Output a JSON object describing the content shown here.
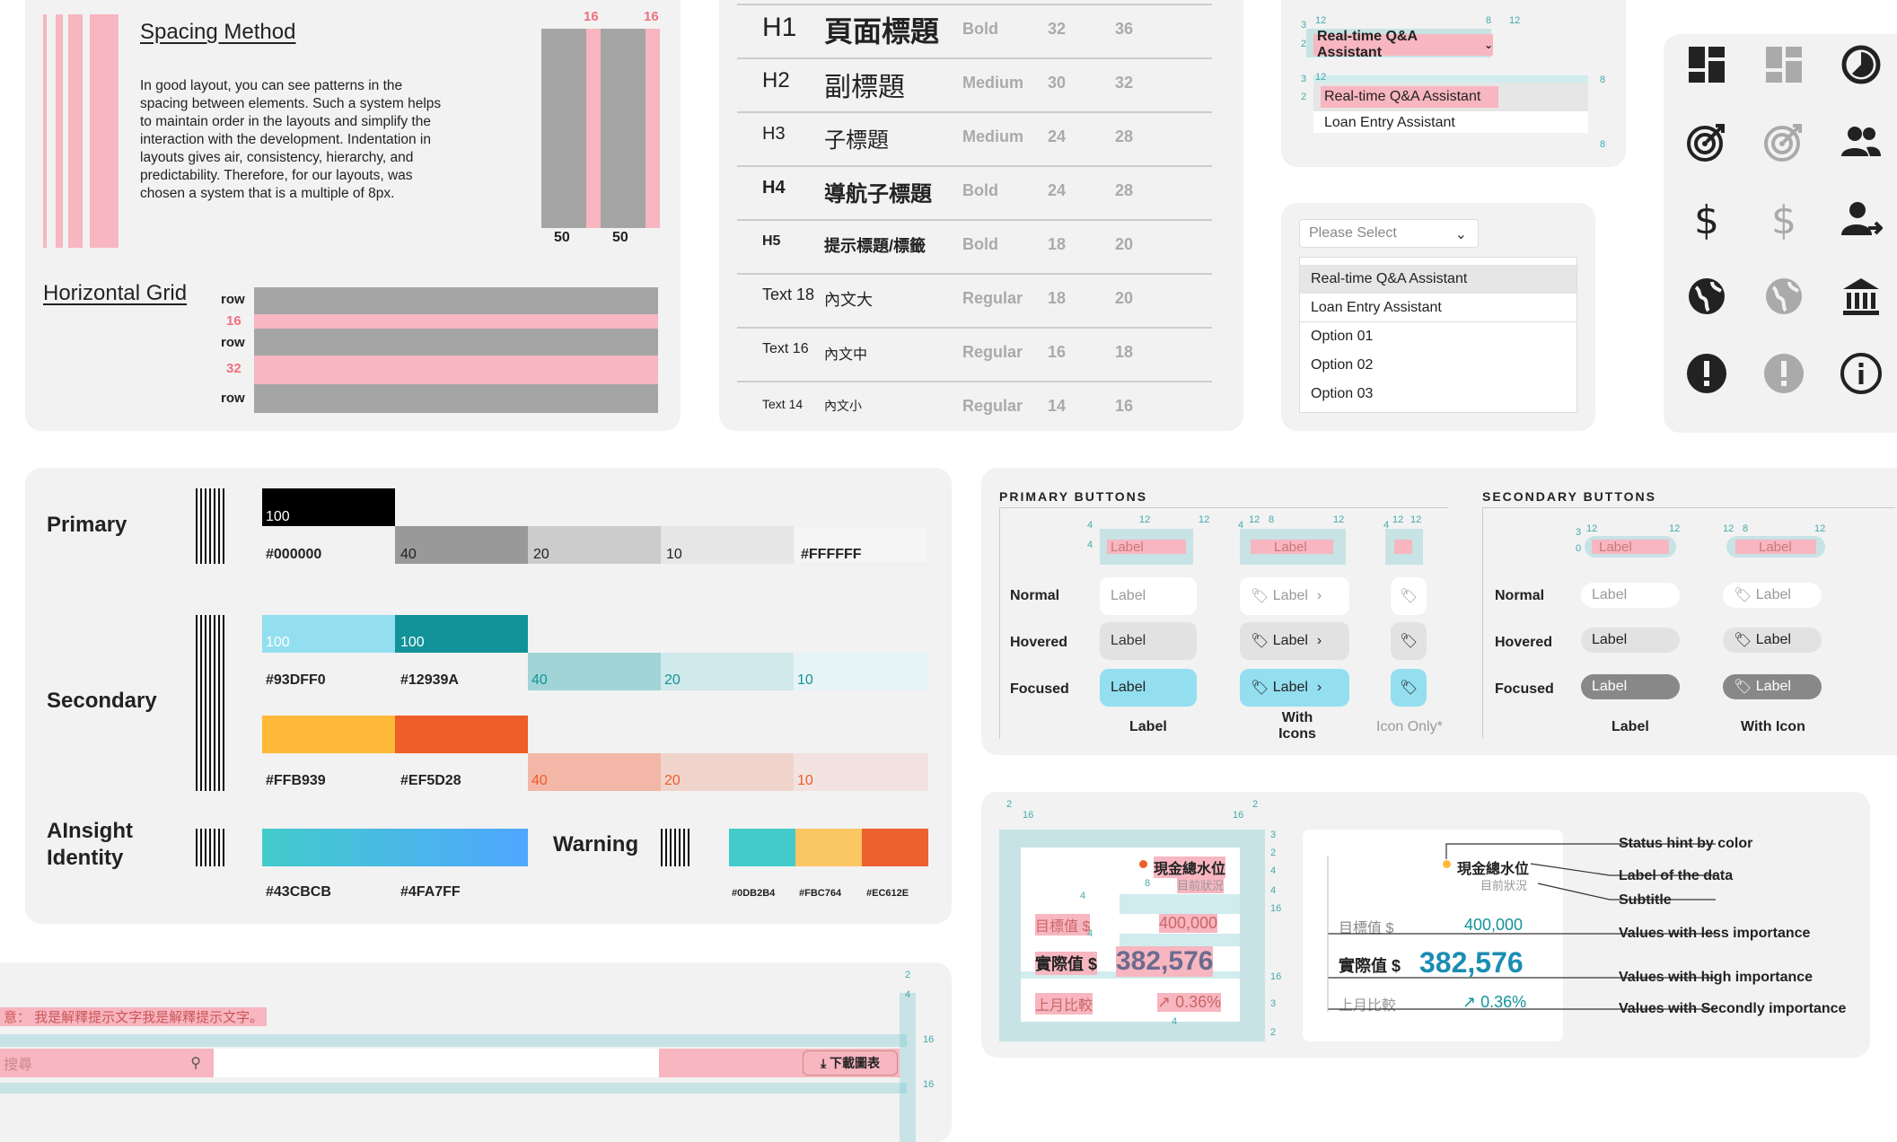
{
  "spacing": {
    "title": "Spacing Method",
    "body": "In good layout, you can see patterns in the spacing between elements. Such a system helps to maintain order in the layouts and simplify the interaction with the development. Indentation in layouts gives air, consistency, hierarchy, and predictability. Therefore, for our layouts, was chosen a system that is a multiple of 8px.",
    "gap1": "16",
    "gap2": "16",
    "col1": "50",
    "col2": "50"
  },
  "hgrid": {
    "title": "Horizontal Grid",
    "labels": [
      "row",
      "16",
      "row",
      "32",
      "row"
    ]
  },
  "typography": {
    "rows": [
      {
        "tag": "H1",
        "zh": "頁面標題",
        "weight": "Bold",
        "size": "32",
        "line": "36"
      },
      {
        "tag": "H2",
        "zh": "副標題",
        "weight": "Medium",
        "size": "30",
        "line": "32"
      },
      {
        "tag": "H3",
        "zh": "子標題",
        "weight": "Medium",
        "size": "24",
        "line": "28"
      },
      {
        "tag": "H4",
        "zh": "導航子標題",
        "weight": "Bold",
        "size": "24",
        "line": "28"
      },
      {
        "tag": "H5",
        "zh": "提示標題/標籤",
        "weight": "Bold",
        "size": "18",
        "line": "20"
      },
      {
        "tag": "Text 18",
        "zh": "內文大",
        "weight": "Regular",
        "size": "18",
        "line": "20"
      },
      {
        "tag": "Text 16",
        "zh": "內文中",
        "weight": "Regular",
        "size": "16",
        "line": "18"
      },
      {
        "tag": "Text 14",
        "zh": "內文小",
        "weight": "Regular",
        "size": "14",
        "line": "16"
      }
    ]
  },
  "dropdown1": {
    "selected": "Real-time Q&A Assistant",
    "options": [
      "Real-time Q&A Assistant",
      "Loan Entry Assistant"
    ],
    "dims": [
      "3",
      "12",
      "2",
      "8",
      "12",
      "3",
      "12",
      "2",
      "8",
      "8"
    ]
  },
  "dropdown2": {
    "placeholder": "Please Select",
    "options": [
      "Real-time Q&A Assistant",
      "Loan Entry Assistant",
      "Option 01",
      "Option 02",
      "Option 03"
    ]
  },
  "icons": [
    "dashboard-icon",
    "dashboard-outline-icon",
    "timer-icon",
    "target-icon",
    "target-outline-icon",
    "people-icon",
    "dollar-icon",
    "dollar-outline-icon",
    "person-arrow-icon",
    "globe-icon",
    "globe-outline-icon",
    "bank-icon",
    "alert-icon",
    "alert-outline-icon",
    "info-icon"
  ],
  "colors": {
    "primary_label": "Primary",
    "primary_steps": [
      "100",
      "40",
      "20",
      "10"
    ],
    "primary_hex": [
      "#000000",
      "#FFFFFF"
    ],
    "secondary_label": "Secondary",
    "sec_a_vals": [
      "100",
      "100",
      "40",
      "20",
      "10"
    ],
    "sec_a_hex": [
      "#93DFF0",
      "#12939A"
    ],
    "sec_b_vals": [
      "40",
      "20",
      "10"
    ],
    "sec_b_hex": [
      "#FFB939",
      "#EF5D28"
    ],
    "identity_label": "AInsight Identity",
    "identity_hex": [
      "#43CBCB",
      "#4FA7FF"
    ],
    "warning_label": "Warning",
    "warning_hex": [
      "#0DB2B4",
      "#FBC764",
      "#EC612E"
    ]
  },
  "buttons": {
    "primary_title": "PRIMARY BUTTONS",
    "secondary_title": "SECONDARY BUTTONS",
    "states": [
      "Normal",
      "Hovered",
      "Focused"
    ],
    "label": "Label",
    "col_label": "Label",
    "col_icons": "With Icons",
    "col_icon_only": "Icon Only*",
    "col_with_icon": "With Icon",
    "dims": [
      "4",
      "12",
      "4",
      "12",
      "4",
      "12",
      "8",
      "12",
      "4",
      "12",
      "12",
      "3",
      "12",
      "12",
      "0",
      "12",
      "8",
      "12"
    ]
  },
  "kpi": {
    "title": "現金總水位",
    "subtitle": "目前狀況",
    "target_label": "目標值 $",
    "target_value": "400,000",
    "actual_label": "實際值 $",
    "actual_value": "382,576",
    "compare_label": "上月比較",
    "compare_value": "↗ 0.36%",
    "dims": [
      "2",
      "16",
      "16",
      "2",
      "3",
      "2",
      "4",
      "4",
      "8",
      "4",
      "4",
      "16",
      "16",
      "3",
      "4",
      "2"
    ],
    "annotations": [
      "Status hint by color",
      "Label of the data",
      "Subtitle",
      "Values with less importance",
      "Values with high importance",
      "Values with Secondly importance"
    ]
  },
  "table": {
    "hint": "意： 我是解釋提示文字我是解釋提示文字。",
    "search_placeholder": "搜尋",
    "download": "下載圖表",
    "dims": [
      "2",
      "4",
      "16",
      "16"
    ]
  }
}
